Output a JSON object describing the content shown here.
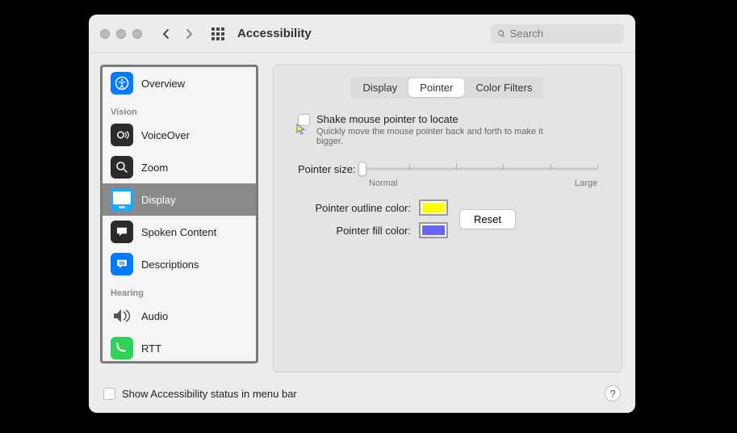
{
  "window": {
    "title": "Accessibility"
  },
  "search": {
    "placeholder": "Search"
  },
  "sidebar": {
    "overview": "Overview",
    "sections": {
      "vision": "Vision",
      "hearing": "Hearing"
    },
    "items": {
      "voiceover": "VoiceOver",
      "zoom": "Zoom",
      "display": "Display",
      "spoken": "Spoken Content",
      "descriptions": "Descriptions",
      "audio": "Audio",
      "rtt": "RTT"
    }
  },
  "tabs": {
    "display": "Display",
    "pointer": "Pointer",
    "colorfilters": "Color Filters"
  },
  "pointer": {
    "shake_label": "Shake mouse pointer to locate",
    "shake_desc": "Quickly move the mouse pointer back and forth to make it bigger.",
    "size_label": "Pointer size:",
    "size_min": "Normal",
    "size_max": "Large",
    "outline_label": "Pointer outline color:",
    "fill_label": "Pointer fill color:",
    "reset": "Reset",
    "outline_color": "#ffff00",
    "fill_color": "#6666ff"
  },
  "footer": {
    "status_label": "Show Accessibility status in menu bar"
  }
}
